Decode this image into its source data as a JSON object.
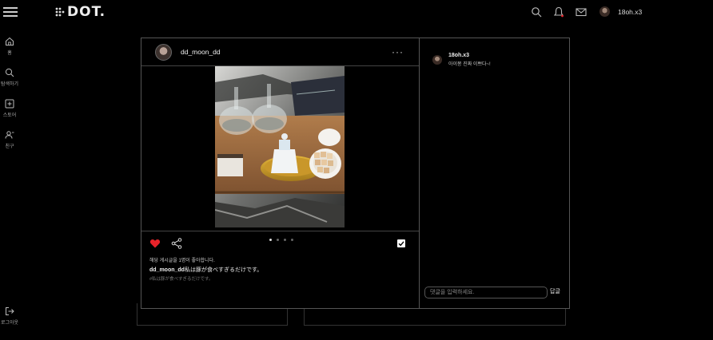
{
  "header": {
    "logo_text": "DOT.",
    "user_name": "18oh.x3"
  },
  "sidebar": {
    "items": [
      {
        "label": "홈",
        "icon": "home-icon"
      },
      {
        "label": "탐색하기",
        "icon": "search-icon"
      },
      {
        "label": "스토어",
        "icon": "plus-square-icon"
      },
      {
        "label": "친구",
        "icon": "friends-icon"
      }
    ],
    "logout_label": "로그아웃"
  },
  "post": {
    "username": "dd_moon_dd",
    "more_label": "···",
    "liked": true,
    "carousel": {
      "total": 4,
      "active_index": 0
    },
    "likes_text": "해당 게시글을 1명이 좋아합니다.",
    "caption_user": "dd_moon_dd",
    "caption_text": "私は豚が食べすぎるだけです。",
    "translation_text": "#私は豚が食べすぎるだけです。"
  },
  "comments": {
    "items": [
      {
        "user": "18oh.x3",
        "text": "아이몽 진짜 이쁘다~!"
      }
    ],
    "input_placeholder": "댓글을 입력하세요.",
    "submit_label": "답글"
  },
  "colors": {
    "background": "#000000",
    "heart": "#e8232a",
    "border": "#555555"
  }
}
